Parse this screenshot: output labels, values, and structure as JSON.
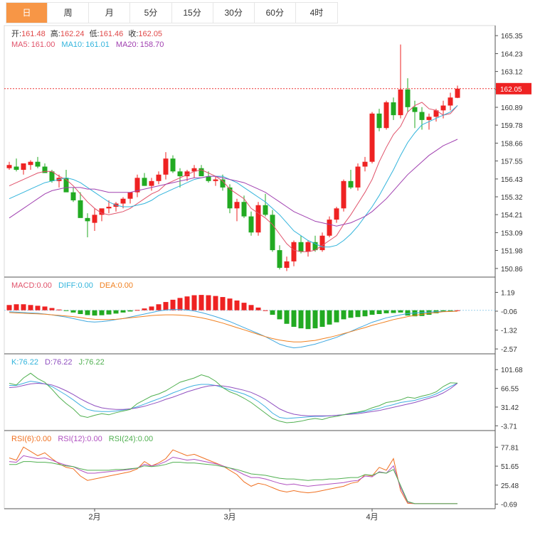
{
  "tabs": [
    {
      "label": "日",
      "active": true
    },
    {
      "label": "周",
      "active": false
    },
    {
      "label": "月",
      "active": false
    },
    {
      "label": "5分",
      "active": false
    },
    {
      "label": "15分",
      "active": false
    },
    {
      "label": "30分",
      "active": false
    },
    {
      "label": "60分",
      "active": false
    },
    {
      "label": "4时",
      "active": false
    }
  ],
  "colors": {
    "up": "#ee2222",
    "down": "#22aa22",
    "ma5": "#e0526a",
    "ma10": "#32b4dc",
    "ma20": "#a040b0",
    "diff": "#40a8e0",
    "dea": "#f08020",
    "k": "#40b0e0",
    "d": "#9050c0",
    "j": "#50b050",
    "rsi6": "#f07020",
    "rsi12": "#b050c0",
    "rsi24": "#50b050",
    "tab_active": "#f79646"
  },
  "chart_data": {
    "type": "candlestick",
    "info": {
      "open_label": "开:",
      "open": "161.48",
      "high_label": "高:",
      "high": "162.24",
      "low_label": "低:",
      "low": "161.46",
      "close_label": "收:",
      "close": "162.05",
      "ma5_label": "MA5:",
      "ma5": "161.00",
      "ma10_label": "MA10:",
      "ma10": "161.01",
      "ma20_label": "MA20:",
      "ma20": "158.70"
    },
    "last_price": "162.05",
    "price_axis": {
      "ticks": [
        "165.35",
        "164.23",
        "163.12",
        "162.00",
        "160.89",
        "159.78",
        "158.66",
        "157.55",
        "156.43",
        "155.32",
        "154.21",
        "153.09",
        "151.98",
        "150.86"
      ],
      "range": [
        150.5,
        165.8
      ]
    },
    "date_labels": [
      {
        "index": 12,
        "label": "2月"
      },
      {
        "index": 31,
        "label": "3月"
      },
      {
        "index": 51,
        "label": "4月"
      }
    ],
    "candles": [
      [
        157.1,
        157.5,
        157.0,
        157.3
      ],
      [
        157.2,
        157.7,
        156.9,
        157.0
      ],
      [
        157.0,
        157.3,
        156.7,
        157.4
      ],
      [
        157.3,
        157.6,
        157.0,
        157.5
      ],
      [
        157.5,
        157.8,
        157.1,
        157.2
      ],
      [
        157.2,
        157.4,
        156.9,
        156.8
      ],
      [
        156.9,
        157.0,
        156.2,
        156.3
      ],
      [
        156.3,
        156.7,
        155.9,
        156.5
      ],
      [
        156.5,
        157.0,
        155.8,
        155.6
      ],
      [
        155.6,
        155.9,
        155.0,
        155.1
      ],
      [
        155.1,
        155.6,
        154.2,
        154.0
      ],
      [
        154.0,
        154.3,
        152.8,
        153.8
      ],
      [
        153.7,
        154.6,
        153.2,
        154.2
      ],
      [
        154.2,
        154.5,
        153.8,
        154.6
      ],
      [
        154.6,
        155.1,
        154.3,
        154.7
      ],
      [
        154.7,
        155.0,
        154.4,
        154.9
      ],
      [
        154.9,
        155.3,
        154.6,
        155.2
      ],
      [
        155.2,
        155.6,
        154.9,
        155.6
      ],
      [
        155.6,
        156.7,
        155.3,
        156.5
      ],
      [
        156.5,
        156.8,
        156.0,
        156.0
      ],
      [
        156.0,
        156.5,
        155.7,
        156.3
      ],
      [
        156.3,
        156.9,
        156.1,
        156.7
      ],
      [
        156.7,
        158.1,
        156.4,
        157.7
      ],
      [
        157.7,
        157.9,
        156.8,
        156.9
      ],
      [
        156.9,
        157.1,
        155.9,
        156.6
      ],
      [
        156.6,
        157.0,
        156.3,
        156.9
      ],
      [
        156.9,
        157.3,
        156.5,
        157.1
      ],
      [
        157.1,
        157.3,
        156.7,
        156.6
      ],
      [
        156.6,
        156.9,
        156.2,
        156.3
      ],
      [
        156.3,
        156.6,
        156.0,
        156.4
      ],
      [
        156.4,
        156.7,
        155.7,
        155.9
      ],
      [
        155.9,
        156.1,
        154.3,
        154.6
      ],
      [
        154.6,
        155.2,
        153.8,
        155.0
      ],
      [
        155.0,
        155.4,
        154.0,
        154.1
      ],
      [
        154.1,
        154.4,
        152.9,
        153.1
      ],
      [
        153.1,
        155.0,
        152.9,
        154.8
      ],
      [
        154.8,
        155.5,
        154.1,
        154.2
      ],
      [
        154.2,
        154.5,
        151.9,
        152.0
      ],
      [
        152.0,
        152.3,
        150.8,
        150.9
      ],
      [
        150.9,
        151.6,
        150.7,
        151.3
      ],
      [
        151.3,
        152.6,
        151.0,
        152.5
      ],
      [
        152.5,
        152.9,
        151.8,
        151.9
      ],
      [
        151.9,
        152.6,
        151.6,
        152.5
      ],
      [
        152.5,
        152.9,
        151.9,
        152.0
      ],
      [
        152.0,
        153.1,
        151.9,
        152.9
      ],
      [
        152.9,
        154.1,
        152.8,
        153.9
      ],
      [
        153.9,
        154.7,
        153.7,
        154.6
      ],
      [
        154.6,
        156.4,
        154.4,
        156.3
      ],
      [
        156.3,
        157.0,
        155.8,
        155.9
      ],
      [
        155.9,
        157.4,
        155.7,
        157.2
      ],
      [
        157.2,
        157.8,
        156.9,
        157.5
      ],
      [
        157.5,
        160.6,
        157.4,
        160.5
      ],
      [
        160.5,
        160.8,
        159.4,
        159.6
      ],
      [
        159.6,
        161.3,
        159.5,
        161.2
      ],
      [
        161.2,
        161.5,
        160.1,
        160.4
      ],
      [
        160.4,
        164.8,
        160.2,
        162.0
      ],
      [
        162.0,
        162.7,
        160.6,
        160.9
      ],
      [
        160.9,
        161.3,
        159.6,
        160.6
      ],
      [
        160.6,
        160.9,
        159.5,
        160.1
      ],
      [
        160.1,
        160.5,
        159.5,
        160.3
      ],
      [
        160.3,
        160.8,
        160.0,
        160.7
      ],
      [
        160.7,
        161.3,
        160.2,
        161.0
      ],
      [
        161.0,
        161.8,
        160.7,
        161.5
      ],
      [
        161.48,
        162.24,
        161.46,
        162.05
      ]
    ],
    "ma5": [
      156.0,
      156.2,
      156.4,
      156.6,
      156.8,
      156.9,
      156.9,
      156.6,
      156.4,
      156.0,
      155.5,
      155.0,
      154.6,
      154.3,
      154.2,
      154.3,
      154.4,
      154.6,
      154.9,
      155.2,
      155.5,
      155.7,
      156.1,
      156.3,
      156.5,
      156.7,
      156.9,
      157.0,
      156.8,
      156.6,
      156.3,
      155.8,
      155.5,
      155.2,
      154.6,
      154.3,
      154.0,
      153.6,
      153.0,
      152.4,
      152.0,
      151.9,
      151.9,
      152.0,
      152.3,
      152.6,
      152.9,
      153.6,
      154.2,
      154.9,
      155.6,
      156.4,
      157.5,
      158.4,
      159.2,
      159.7,
      160.6,
      161.0,
      161.2,
      160.8,
      160.7,
      160.4,
      160.5,
      161.0
    ],
    "ma10": [
      155.2,
      155.4,
      155.6,
      155.8,
      156.0,
      156.2,
      156.3,
      156.4,
      156.5,
      156.4,
      156.2,
      155.9,
      155.6,
      155.3,
      155.0,
      154.8,
      154.7,
      154.7,
      154.8,
      154.9,
      155.1,
      155.4,
      155.6,
      155.8,
      156.0,
      156.2,
      156.4,
      156.5,
      156.6,
      156.6,
      156.6,
      156.4,
      156.2,
      155.9,
      155.6,
      155.3,
      155.0,
      154.6,
      154.2,
      153.7,
      153.2,
      152.9,
      152.6,
      152.4,
      152.2,
      152.2,
      152.3,
      152.6,
      153.0,
      153.5,
      154.1,
      154.7,
      155.4,
      156.2,
      157.0,
      157.9,
      158.7,
      159.3,
      159.8,
      160.0,
      160.2,
      160.4,
      160.6,
      161.0
    ],
    "ma20": [
      154.0,
      154.3,
      154.6,
      154.9,
      155.2,
      155.5,
      155.7,
      155.8,
      155.9,
      155.9,
      155.9,
      155.8,
      155.8,
      155.7,
      155.6,
      155.6,
      155.6,
      155.6,
      155.7,
      155.8,
      155.9,
      156.0,
      156.1,
      156.2,
      156.3,
      156.4,
      156.5,
      156.5,
      156.6,
      156.6,
      156.5,
      156.4,
      156.3,
      156.2,
      156.0,
      155.8,
      155.6,
      155.3,
      155.0,
      154.7,
      154.4,
      154.2,
      154.0,
      153.8,
      153.7,
      153.6,
      153.5,
      153.6,
      153.7,
      153.9,
      154.1,
      154.4,
      154.8,
      155.2,
      155.7,
      156.2,
      156.7,
      157.1,
      157.5,
      157.9,
      158.2,
      158.5,
      158.7,
      158.9
    ],
    "macd_info": {
      "macd_label": "MACD:",
      "macd": "0.00",
      "diff_label": "DIFF:",
      "diff": "0.00",
      "dea_label": "DEA:",
      "dea": "0.00"
    },
    "macd_axis": {
      "ticks": [
        "1.19",
        "-0.06",
        "-1.32",
        "-2.57"
      ],
      "range": [
        -2.8,
        1.45
      ]
    },
    "macd_hist": [
      0.35,
      0.4,
      0.4,
      0.35,
      0.3,
      0.25,
      0.15,
      0.05,
      -0.05,
      -0.15,
      -0.25,
      -0.32,
      -0.35,
      -0.33,
      -0.28,
      -0.22,
      -0.15,
      -0.08,
      0.02,
      0.12,
      0.25,
      0.4,
      0.55,
      0.7,
      0.82,
      0.92,
      1.0,
      1.02,
      1.0,
      0.95,
      0.88,
      0.78,
      0.65,
      0.5,
      0.35,
      0.18,
      0.0,
      -0.3,
      -0.6,
      -0.9,
      -1.1,
      -1.2,
      -1.25,
      -1.2,
      -1.1,
      -0.95,
      -0.8,
      -0.6,
      -0.5,
      -0.45,
      -0.4,
      -0.3,
      -0.25,
      -0.2,
      -0.18,
      -0.15,
      -0.35,
      -0.4,
      -0.38,
      -0.3,
      -0.2,
      -0.1,
      -0.05,
      0.0
    ],
    "macd_diff": [
      -0.1,
      -0.12,
      -0.15,
      -0.18,
      -0.2,
      -0.25,
      -0.3,
      -0.38,
      -0.45,
      -0.55,
      -0.65,
      -0.75,
      -0.78,
      -0.75,
      -0.7,
      -0.62,
      -0.55,
      -0.45,
      -0.35,
      -0.25,
      -0.15,
      -0.05,
      0.02,
      0.05,
      0.05,
      0.02,
      -0.05,
      -0.15,
      -0.28,
      -0.42,
      -0.58,
      -0.75,
      -0.95,
      -1.15,
      -1.35,
      -1.55,
      -1.75,
      -2.0,
      -2.25,
      -2.4,
      -2.5,
      -2.45,
      -2.35,
      -2.25,
      -2.1,
      -1.95,
      -1.8,
      -1.6,
      -1.4,
      -1.2,
      -1.0,
      -0.8,
      -0.65,
      -0.5,
      -0.4,
      -0.3,
      -0.22,
      -0.18,
      -0.15,
      -0.12,
      -0.1,
      -0.08,
      -0.07,
      -0.06
    ],
    "macd_dea": [
      -0.15,
      -0.18,
      -0.2,
      -0.22,
      -0.24,
      -0.26,
      -0.3,
      -0.34,
      -0.38,
      -0.42,
      -0.48,
      -0.55,
      -0.6,
      -0.62,
      -0.62,
      -0.6,
      -0.55,
      -0.5,
      -0.45,
      -0.4,
      -0.35,
      -0.32,
      -0.3,
      -0.3,
      -0.32,
      -0.36,
      -0.42,
      -0.5,
      -0.6,
      -0.72,
      -0.85,
      -1.0,
      -1.15,
      -1.3,
      -1.45,
      -1.6,
      -1.75,
      -1.88,
      -1.98,
      -2.05,
      -2.1,
      -2.1,
      -2.05,
      -2.0,
      -1.9,
      -1.8,
      -1.68,
      -1.55,
      -1.42,
      -1.28,
      -1.15,
      -1.0,
      -0.88,
      -0.75,
      -0.62,
      -0.52,
      -0.42,
      -0.34,
      -0.27,
      -0.2,
      -0.15,
      -0.1,
      -0.08,
      -0.06
    ],
    "kdj_info": {
      "k_label": "K:",
      "k": "76.22",
      "d_label": "D:",
      "d": "76.22",
      "j_label": "J:",
      "j": "76.22"
    },
    "kdj_axis": {
      "ticks": [
        "101.68",
        "66.55",
        "31.42",
        "-3.71"
      ],
      "range": [
        -10,
        110
      ]
    },
    "kdj_k": [
      72,
      72,
      76,
      80,
      78,
      75,
      70,
      62,
      54,
      45,
      35,
      27,
      24,
      23,
      23,
      24,
      26,
      28,
      32,
      37,
      42,
      47,
      52,
      58,
      63,
      68,
      72,
      74,
      74,
      72,
      68,
      64,
      60,
      56,
      50,
      42,
      32,
      20,
      12,
      10,
      11,
      12,
      13,
      14,
      14,
      15,
      16,
      17,
      19,
      21,
      23,
      26,
      29,
      33,
      36,
      40,
      42,
      44,
      48,
      51,
      56,
      63,
      70,
      76.22
    ],
    "kdj_d": [
      68,
      69,
      72,
      75,
      76,
      75,
      73,
      68,
      62,
      55,
      47,
      40,
      34,
      30,
      28,
      27,
      27,
      28,
      30,
      33,
      37,
      41,
      46,
      50,
      55,
      60,
      64,
      68,
      71,
      72,
      71,
      69,
      66,
      63,
      59,
      53,
      46,
      37,
      28,
      22,
      18,
      16,
      15,
      15,
      15,
      15,
      16,
      17,
      18,
      19,
      21,
      23,
      25,
      28,
      31,
      34,
      37,
      40,
      44,
      48,
      52,
      58,
      66,
      76.22
    ],
    "kdj_j": [
      76,
      73,
      86,
      95,
      85,
      78,
      65,
      50,
      38,
      28,
      15,
      12,
      16,
      19,
      17,
      21,
      24,
      27,
      38,
      45,
      52,
      56,
      62,
      70,
      78,
      82,
      86,
      92,
      88,
      80,
      68,
      60,
      55,
      48,
      40,
      30,
      20,
      10,
      5,
      2,
      3,
      5,
      8,
      10,
      8,
      12,
      14,
      17,
      20,
      22,
      25,
      30,
      34,
      40,
      42,
      45,
      50,
      48,
      52,
      55,
      60,
      70,
      77,
      76.22
    ],
    "rsi_info": {
      "rsi6_label": "RSI(6):",
      "rsi6": "0.00",
      "rsi12_label": "RSI(12):",
      "rsi12": "0.00",
      "rsi24_label": "RSI(24):",
      "rsi24": "0.00"
    },
    "rsi_axis": {
      "ticks": [
        "77.81",
        "51.65",
        "25.48",
        "-0.69"
      ],
      "range": [
        -5,
        85
      ]
    },
    "rsi6": [
      63,
      60,
      78,
      72,
      66,
      70,
      62,
      55,
      50,
      48,
      38,
      32,
      34,
      36,
      38,
      40,
      42,
      44,
      48,
      58,
      52,
      56,
      62,
      74,
      70,
      66,
      68,
      64,
      60,
      56,
      52,
      46,
      40,
      30,
      24,
      28,
      26,
      22,
      18,
      16,
      18,
      16,
      15,
      16,
      18,
      20,
      22,
      24,
      28,
      30,
      40,
      38,
      50,
      46,
      62,
      18,
      0.5,
      0,
      0,
      0,
      0,
      0,
      0,
      0
    ],
    "rsi12": [
      58,
      57,
      66,
      64,
      62,
      63,
      60,
      56,
      53,
      51,
      46,
      42,
      42,
      43,
      44,
      45,
      46,
      47,
      49,
      54,
      52,
      54,
      58,
      64,
      62,
      60,
      61,
      59,
      57,
      55,
      52,
      49,
      45,
      40,
      36,
      36,
      34,
      31,
      28,
      26,
      27,
      25,
      24,
      25,
      26,
      27,
      28,
      29,
      31,
      32,
      38,
      37,
      44,
      42,
      52,
      22,
      2,
      0,
      0,
      0,
      0,
      0,
      0,
      0
    ],
    "rsi24": [
      54,
      54,
      58,
      58,
      57,
      57,
      56,
      54,
      52,
      51,
      48,
      46,
      46,
      46,
      46,
      47,
      47,
      48,
      49,
      52,
      51,
      52,
      54,
      57,
      57,
      56,
      56,
      55,
      54,
      53,
      51,
      49,
      47,
      44,
      41,
      40,
      39,
      37,
      35,
      34,
      34,
      33,
      32,
      33,
      33,
      34,
      34,
      35,
      36,
      36,
      40,
      39,
      43,
      42,
      47,
      25,
      3,
      0,
      0,
      0,
      0,
      0,
      0,
      0
    ]
  }
}
